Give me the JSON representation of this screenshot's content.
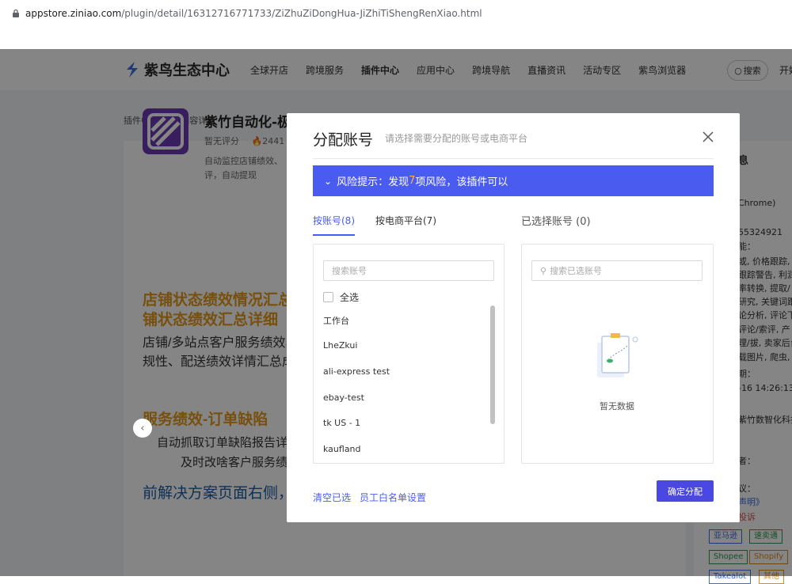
{
  "browser": {
    "url_host": "appstore.ziniao.com",
    "url_path": "/plugin/detail/16312716771733/ZiZhuZiDongHua-JiZhiTiShengRenXiao.html"
  },
  "nav": {
    "logo_text": "紫鸟生态中心",
    "items": [
      "全球开店",
      "跨境服务",
      "插件中心",
      "应用中心",
      "跨境导航",
      "直播资讯",
      "活动专区",
      "紫鸟浏览器"
    ],
    "search_label": "搜索",
    "right_label": "开始"
  },
  "breadcrumb": {
    "root": "插件中心",
    "sep": ">",
    "current": "内容详情"
  },
  "plugin": {
    "title": "紫竹自动化-极",
    "rating": "暂无评分",
    "heat": "2441",
    "desc": "自动监控店铺绩效、评，自动提现"
  },
  "banner": {
    "line1": "店铺状态绩效情况汇总",
    "line2": "铺状态绩效汇总详细",
    "line3": "店铺/多站点客户服务绩效、",
    "line4": "规性、配送绩效详情汇总成",
    "line5": "服务绩效-订单缺陷",
    "line6": "自动抓取订单缺陷报告详",
    "line7": "及时改啥客户服务绩",
    "bottom": "前解决方案页面右侧，勾选所需应用并创建任务。一次设置可持续实现无人值守、自动"
  },
  "side": {
    "heading": "息",
    "lines": [
      "Chrome)",
      "55324921",
      "能：",
      "或, 价格跟踪, 产",
      "跟踪警告, 利润",
      "率转换, 提取/",
      "研究, 关键词跟",
      "论分析, 评论下",
      "评论/索评, 产",
      "理/拔, 卖家后台",
      "载图片, 爬虫, 数",
      "期：",
      "-16 14:26:13",
      "紫竹数智化科技",
      "者：",
      "议：",
      "声明》",
      "投诉"
    ],
    "tags": [
      "亚马逊",
      "速卖通",
      "Shopee",
      "Shopify",
      "Takealot",
      "其他"
    ]
  },
  "modal": {
    "title": "分配账号",
    "subtitle": "请选择需要分配的账号或电商平台",
    "risk_prefix": "风险提示：发现",
    "risk_count": "7",
    "risk_suffix": "项风险，该插件可以",
    "tabs": [
      "按账号(8)",
      "按电商平台(7)"
    ],
    "selected_title": "已选择账号 (0)",
    "search_placeholder": "搜索账号",
    "selected_search_placeholder": "搜索已选账号",
    "select_all": "全选",
    "accounts": [
      "工作台",
      "LheZkui",
      "ali-express test",
      "ebay-test",
      "tk US - 1",
      "kaufland"
    ],
    "empty_text": "暂无数据",
    "clear_label": "清空已选",
    "whitelist_label": "员工白名单设置",
    "confirm_label": "确定分配"
  },
  "colors": {
    "accent": "#4a5cf0",
    "risk_num": "#ffb23b",
    "confirm": "#4a48e0"
  }
}
